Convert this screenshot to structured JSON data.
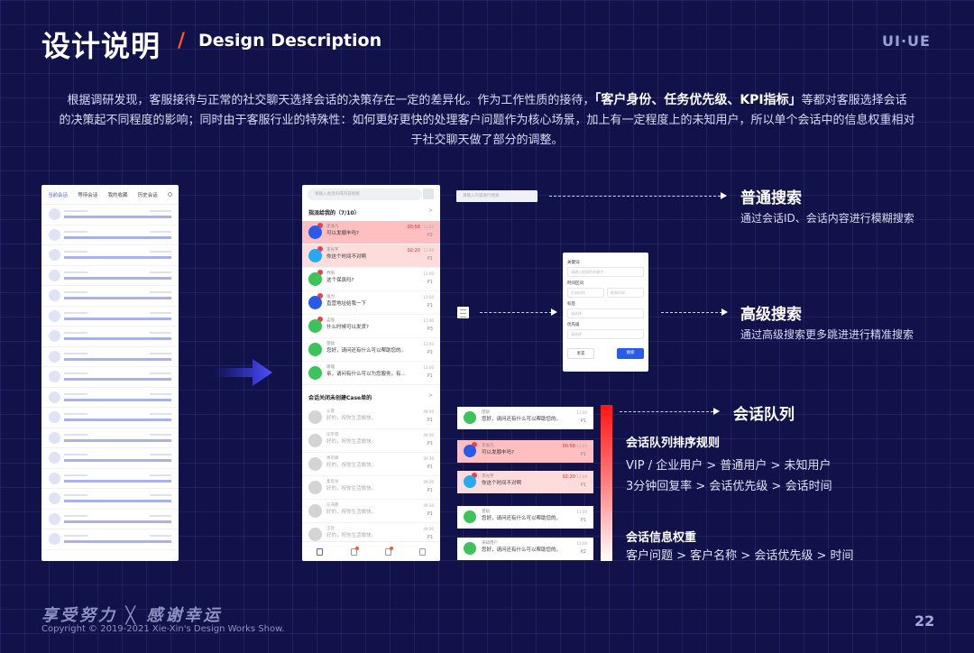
{
  "header": {
    "title": "设计说明",
    "slash": "/",
    "subtitle": "Design Description",
    "tag": "UI·UE"
  },
  "intro": {
    "line1a": "根据调研发现，客服接待与正常的社交聊天选择会话的决策存在一定的差异化。作为工作性质的接待，",
    "highlight": "「客户身份、任务优先级、KPI指标」",
    "line1b": "等都对客服选择会话",
    "line2": "的决策起不同程度的影响；同时由于客服行业的特殊性：如何更好更快的处理客户问题作为核心场景，加上有一定程度上的未知用户，所以单个会话中的信息权重相对",
    "line3": "于社交聊天做了部分的调整。"
  },
  "old_phone": {
    "tabs": [
      "当前会话",
      "等待会话",
      "我的收藏",
      "历史会话"
    ],
    "row_count": 17
  },
  "new_phone": {
    "search_placeholder": "请输入会话ID或内容搜索",
    "section1": "指派给我的（7/10）",
    "section1_chevron": ">",
    "messages1": [
      {
        "name": "李逸凡",
        "text": "可以发顺丰吗?",
        "time": "11:00",
        "priority": "P2",
        "countdown": "00:58",
        "style": "pink1",
        "avatar": "b",
        "badge": true
      },
      {
        "name": "李光宇",
        "text": "你这个时间不对啊",
        "time": "11:00",
        "priority": "P1",
        "countdown": "02:20",
        "style": "pink2",
        "avatar": "t",
        "badge": true
      },
      {
        "name": "乔阳",
        "text": "这个保真吗?",
        "time": "11:00",
        "priority": "P1",
        "countdown": "",
        "style": "",
        "avatar": "g",
        "badge": true
      },
      {
        "name": "张力",
        "text": "直营地址给我一下",
        "time": "11:00",
        "priority": "P1",
        "countdown": "",
        "style": "",
        "avatar": "b",
        "badge": true
      },
      {
        "name": "孟强",
        "text": "什么时候可以发货?",
        "time": "11:00",
        "priority": "P3",
        "countdown": "",
        "style": "",
        "avatar": "g",
        "badge": true
      },
      {
        "name": "望幼",
        "text": "您好，请问还有什么可以帮助您的。",
        "time": "11:00",
        "priority": "P1",
        "countdown": "",
        "style": "",
        "avatar": "g",
        "badge": false
      },
      {
        "name": "谢瑞",
        "text": "亲，请问有什么可以为您服务，有…",
        "time": "11:00",
        "priority": "P1",
        "countdown": "",
        "style": "",
        "avatar": "g",
        "badge": false
      }
    ],
    "section2": "会话关闭未创建Case单的",
    "section2_chevron": ">",
    "messages2": [
      {
        "name": "从夏",
        "text": "好的，祝你生活愉快。",
        "time": "09:30",
        "priority": "P1"
      },
      {
        "name": "毕宇蓉",
        "text": "好的，祝你生活愉快。",
        "time": "09:30",
        "priority": "P1"
      },
      {
        "name": "奉宗峰",
        "text": "好的，祝你生活愉快。",
        "time": "09:30",
        "priority": "P1"
      },
      {
        "name": "秦思龙",
        "text": "好的，祝你生活愉快。",
        "time": "09:30",
        "priority": "P1"
      },
      {
        "name": "任海鹏",
        "text": "好的，祝你生活愉快。",
        "time": "09:30",
        "priority": "P1"
      },
      {
        "name": "王智",
        "text": "好的，祝你生活愉快。",
        "time": "09:30",
        "priority": "P1"
      }
    ],
    "tabbar_icons": [
      "chat-icon",
      "clock-icon",
      "home-icon",
      "document-icon"
    ]
  },
  "normal_search": {
    "placeholder": "请输入内容进行搜索",
    "title": "普通搜索",
    "desc": "通过会话ID、会话内容进行模糊搜索"
  },
  "advanced_search": {
    "title": "高级搜索",
    "desc": "通过高级搜索更多跳进进行精准搜索",
    "panel": {
      "keyword_label": "关键词",
      "keyword_ph": "请输入搜索的关键字",
      "time_label": "时间区间",
      "start_ph": "开始时间",
      "end_ph": "结束时间",
      "tag_label": "标签",
      "tag_ph": "请选择",
      "priority_label": "优先级",
      "priority_ph": "请选择",
      "reset": "重置",
      "search": "搜索"
    }
  },
  "queue": {
    "title": "会话队列",
    "rules_title": "会话队列排序规则",
    "rule1": "VIP / 企业用户 > 普通用户 > 未知用户",
    "rule2": "3分钟回复率 > 会话优先级 >  会话时间",
    "weight_title": "会话信息权重",
    "weight": "客户问题  > 客户名称 >  会话优先级 > 时间",
    "cards": [
      {
        "name": "望幼",
        "text": "您好，请问还有什么可以帮助您的。",
        "time": "11:00",
        "priority": "P1",
        "countdown": "",
        "style": "",
        "avatar": "g",
        "badge": false
      },
      {
        "name": "李逸凡",
        "text": "可以发顺丰吗?",
        "time": "11:00",
        "priority": "P1",
        "countdown": "00:58",
        "style": "pk1",
        "avatar": "b",
        "badge": true
      },
      {
        "name": "李光宇",
        "text": "你这个时间不对啊",
        "time": "11:00",
        "priority": "P1",
        "countdown": "02:20",
        "style": "pk2",
        "avatar": "t",
        "badge": true
      },
      {
        "name": "望幼",
        "text": "您好，请问还有什么可以帮助您的。",
        "time": "11:00",
        "priority": "P1",
        "countdown": "",
        "style": "",
        "avatar": "g",
        "badge": false
      },
      {
        "name": "未知用户",
        "text": "您好，请问还有什么可以帮助您的。",
        "time": "11:00",
        "priority": "P2",
        "countdown": "",
        "style": "",
        "avatar": "g",
        "badge": false
      }
    ]
  },
  "footer": {
    "slogan": "享受努力 ╳ 感谢幸运",
    "copyright": "Copyright © 2019-2021 Xie-Xin's Design Works Show.",
    "page": "22"
  }
}
